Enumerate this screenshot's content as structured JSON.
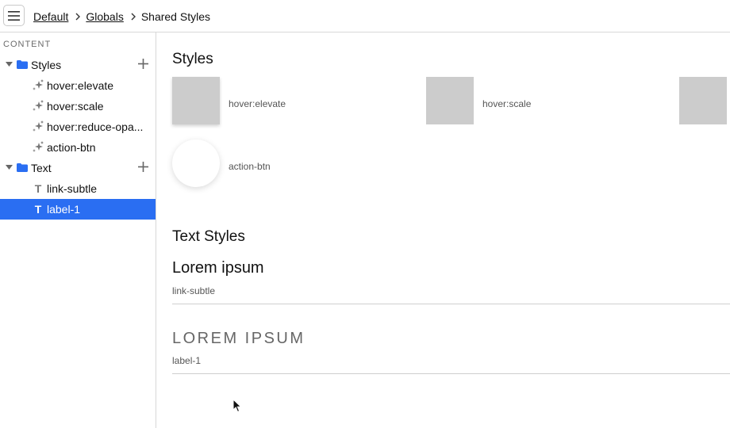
{
  "breadcrumb": {
    "items": [
      "Default",
      "Globals"
    ],
    "current": "Shared Styles"
  },
  "sidebar": {
    "heading": "CONTENT",
    "groups": [
      {
        "label": "Styles",
        "items": [
          "hover:elevate",
          "hover:scale",
          "hover:reduce-opa...",
          "action-btn"
        ]
      },
      {
        "label": "Text",
        "items": [
          "link-subtle",
          "label-1"
        ]
      }
    ],
    "selected": "label-1"
  },
  "main": {
    "styles_title": "Styles",
    "styles": [
      {
        "label": "hover:elevate"
      },
      {
        "label": "hover:scale"
      },
      {
        "label": "action-btn"
      }
    ],
    "text_styles_title": "Text Styles",
    "text_styles": [
      {
        "sample": "Lorem ipsum",
        "label": "link-subtle"
      },
      {
        "sample": "LOREM IPSUM",
        "label": "label-1"
      }
    ]
  },
  "colors": {
    "accent": "#2a6ef2",
    "swatch": "#cccccc",
    "folder": "#2a6ef2"
  }
}
